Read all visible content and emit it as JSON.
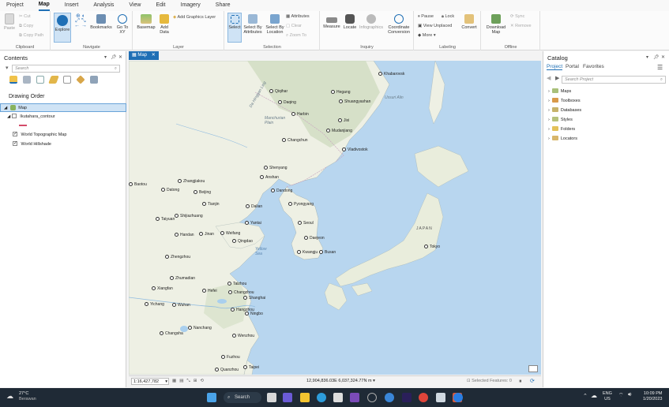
{
  "menu": [
    "Project",
    "Map",
    "Insert",
    "Analysis",
    "View",
    "Edit",
    "Imagery",
    "Share"
  ],
  "menu_active": "Map",
  "ribbon": {
    "clipboard": {
      "label": "Clipboard",
      "paste": "Paste",
      "cut": "Cut",
      "copy": "Copy",
      "copy_path": "Copy Path"
    },
    "navigate": {
      "label": "Navigate",
      "explore": "Explore",
      "bookmarks": "Bookmarks",
      "goto": "Go To XY"
    },
    "layer": {
      "label": "Layer",
      "basemap": "Basemap",
      "add_data": "Add Data",
      "add_graphics": "Add Graphics Layer"
    },
    "selection": {
      "label": "Selection",
      "select": "Select",
      "by_attr": "Select By Attributes",
      "by_loc": "Select By Location",
      "attributes": "Attributes",
      "clear": "Clear",
      "zoom_to": "Zoom To"
    },
    "inquiry": {
      "label": "Inquiry",
      "measure": "Measure",
      "locate": "Locate",
      "infographics": "Infographics",
      "coord": "Coordinate Conversion"
    },
    "labeling": {
      "label": "Labeling",
      "pause": "Pause",
      "lock": "Lock",
      "view_unplaced": "View Unplaced",
      "more": "More",
      "convert": "Convert"
    },
    "offline": {
      "label": "Offline",
      "download": "Download Map",
      "sync": "Sync",
      "remove": "Remove"
    }
  },
  "contents": {
    "title": "Contents",
    "search_placeholder": "Search",
    "drawing_order": "Drawing Order",
    "layers": [
      {
        "name": "Map",
        "checked": false,
        "selected": true
      },
      {
        "name": "Ikutahara_contour",
        "checked": false
      },
      {
        "name": "World Topographic Map",
        "checked": true
      },
      {
        "name": "World Hillshade",
        "checked": true
      }
    ]
  },
  "map_tab": "Map",
  "map": {
    "cities": [
      {
        "name": "Khabarovsk"
      },
      {
        "name": "Qiqihar"
      },
      {
        "name": "Hegang"
      },
      {
        "name": "Daqing"
      },
      {
        "name": "Shuangyashan"
      },
      {
        "name": "Harbin"
      },
      {
        "name": "Jixi"
      },
      {
        "name": "Mudanjiang"
      },
      {
        "name": "Changchun"
      },
      {
        "name": "Vladivostok"
      },
      {
        "name": "Shenyang"
      },
      {
        "name": "Anshan"
      },
      {
        "name": "Zhangjiakou"
      },
      {
        "name": "Baotou"
      },
      {
        "name": "Datong"
      },
      {
        "name": "Beijing"
      },
      {
        "name": "Dandong"
      },
      {
        "name": "Tianjin"
      },
      {
        "name": "Dalian"
      },
      {
        "name": "Pyongyang"
      },
      {
        "name": "Taiyuan"
      },
      {
        "name": "Shijiazhuang"
      },
      {
        "name": "Yantai"
      },
      {
        "name": "Seoul"
      },
      {
        "name": "Handan"
      },
      {
        "name": "Jinan"
      },
      {
        "name": "Weifang"
      },
      {
        "name": "Daejeon"
      },
      {
        "name": "Qingdao"
      },
      {
        "name": "Kwangju"
      },
      {
        "name": "Busan"
      },
      {
        "name": "Tokyo"
      },
      {
        "name": "Zhengzhou"
      },
      {
        "name": "Zhumadian"
      },
      {
        "name": "Xiangfan"
      },
      {
        "name": "Hefei"
      },
      {
        "name": "Taizhou"
      },
      {
        "name": "Changzhou"
      },
      {
        "name": "Shanghai"
      },
      {
        "name": "Yichang"
      },
      {
        "name": "Wuhan"
      },
      {
        "name": "Hangzhou"
      },
      {
        "name": "Ningbo"
      },
      {
        "name": "Nanchang"
      },
      {
        "name": "Changsha"
      },
      {
        "name": "Wenzhou"
      },
      {
        "name": "Fuzhou"
      },
      {
        "name": "Quanzhou"
      },
      {
        "name": "Taipei"
      }
    ],
    "areas": [
      "JAPAN",
      "Yellow Sea",
      "Manchurian Plain",
      "Da Hinggan Ling",
      "Ussuri Alin"
    ]
  },
  "status": {
    "scale": "1:16,427,782",
    "coords": "12,904,836.03E 6,037,324.77N m",
    "selected": "Selected Features: 0"
  },
  "catalog": {
    "title": "Catalog",
    "tabs": [
      "Project",
      "Portal",
      "Favorites"
    ],
    "search_placeholder": "Search Project",
    "items": [
      "Maps",
      "Toolboxes",
      "Databases",
      "Styles",
      "Folders",
      "Locators"
    ]
  },
  "taskbar": {
    "temp": "27°C",
    "weather": "Berawan",
    "search": "Search",
    "lang": "ENG",
    "region": "US",
    "time": "10:09 PM",
    "date": "1/20/2023"
  },
  "colors": {
    "accent": "#1f6fb5",
    "sea": "#b8d6ef",
    "land": "#eef0e4",
    "forest": "#cfdcc0"
  }
}
